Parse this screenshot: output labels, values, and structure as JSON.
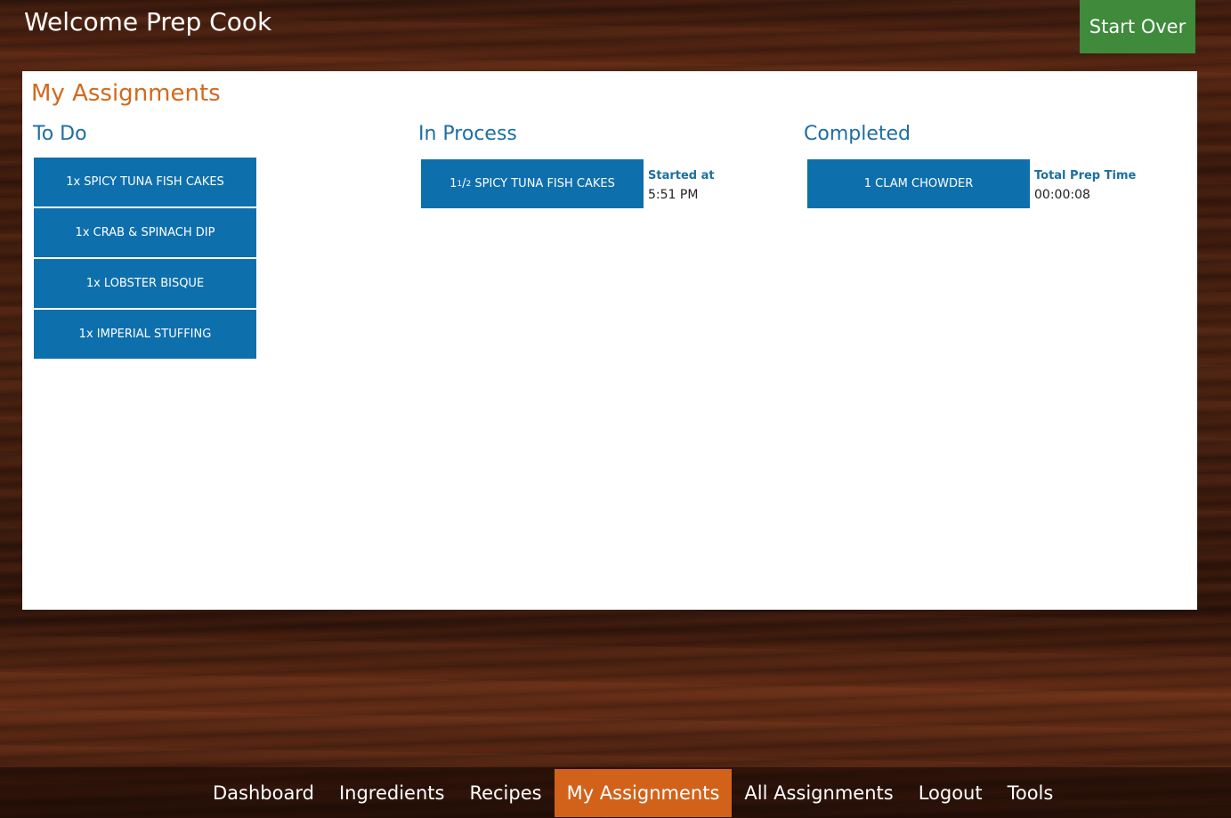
{
  "header": {
    "welcome": "Welcome Prep Cook",
    "start_over_label": "Start Over"
  },
  "main": {
    "title": "My Assignments",
    "columns": {
      "todo": {
        "heading": "To Do",
        "items": [
          "1x SPICY TUNA FISH CAKES",
          "1x CRAB & SPINACH DIP",
          "1x LOBSTER BISQUE",
          "1x IMPERIAL STUFFING"
        ]
      },
      "in_process": {
        "heading": "In Process",
        "items": [
          {
            "qty_whole": "1",
            "qty_num": "1",
            "qty_den": "2",
            "name": "SPICY TUNA FISH CAKES",
            "meta_label": "Started at",
            "meta_value": "5:51 PM"
          }
        ]
      },
      "completed": {
        "heading": "Completed",
        "items": [
          {
            "label": "1 CLAM CHOWDER",
            "meta_label": "Total Prep Time",
            "meta_value": "00:00:08"
          }
        ]
      }
    }
  },
  "nav": {
    "items": [
      {
        "label": "Dashboard",
        "active": false
      },
      {
        "label": "Ingredients",
        "active": false
      },
      {
        "label": "Recipes",
        "active": false
      },
      {
        "label": "My Assignments",
        "active": true
      },
      {
        "label": "All Assignments",
        "active": false
      },
      {
        "label": "Logout",
        "active": false
      },
      {
        "label": "Tools",
        "active": false
      }
    ]
  },
  "colors": {
    "accent_orange": "#d2621a",
    "task_blue": "#0e6fad",
    "heading_blue": "#1c6ea4",
    "start_over_green": "#3f8a3b"
  }
}
